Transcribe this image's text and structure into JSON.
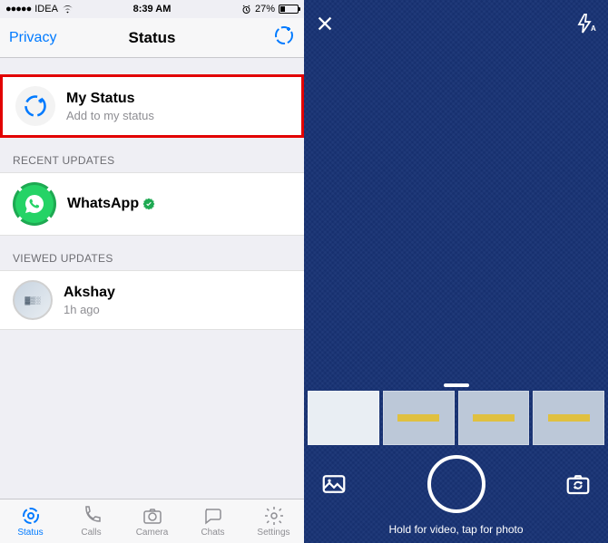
{
  "statusbar": {
    "carrier": "IDEA",
    "time": "8:39 AM",
    "battery_pct": "27%"
  },
  "nav": {
    "left": "Privacy",
    "title": "Status"
  },
  "my_status": {
    "title": "My Status",
    "subtitle": "Add to my status"
  },
  "sections": {
    "recent": "RECENT UPDATES",
    "viewed": "VIEWED UPDATES"
  },
  "recent": [
    {
      "name": "WhatsApp",
      "verified": true
    }
  ],
  "viewed": [
    {
      "name": "Akshay",
      "time": "1h ago"
    }
  ],
  "tabs": {
    "status": "Status",
    "calls": "Calls",
    "camera": "Camera",
    "chats": "Chats",
    "settings": "Settings"
  },
  "camera": {
    "hint": "Hold for video, tap for photo"
  }
}
